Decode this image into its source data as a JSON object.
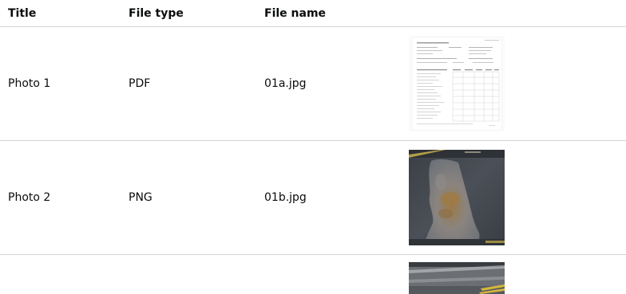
{
  "table": {
    "headers": {
      "title": "Title",
      "file_type": "File type",
      "file_name": "File name"
    },
    "rows": [
      {
        "title": "Photo 1",
        "file_type": "PDF",
        "file_name": "01a.jpg",
        "thumbnail": "document-form-thumbnail"
      },
      {
        "title": "Photo 2",
        "file_type": "PNG",
        "file_name": "01b.jpg",
        "thumbnail": "road-pothole-photo-thumbnail"
      },
      {
        "title": "",
        "file_type": "",
        "file_name": "",
        "thumbnail": "road-markings-photo-thumbnail"
      }
    ]
  },
  "colors": {
    "text": "#0b0c0c",
    "divider": "#cfd2d4"
  }
}
